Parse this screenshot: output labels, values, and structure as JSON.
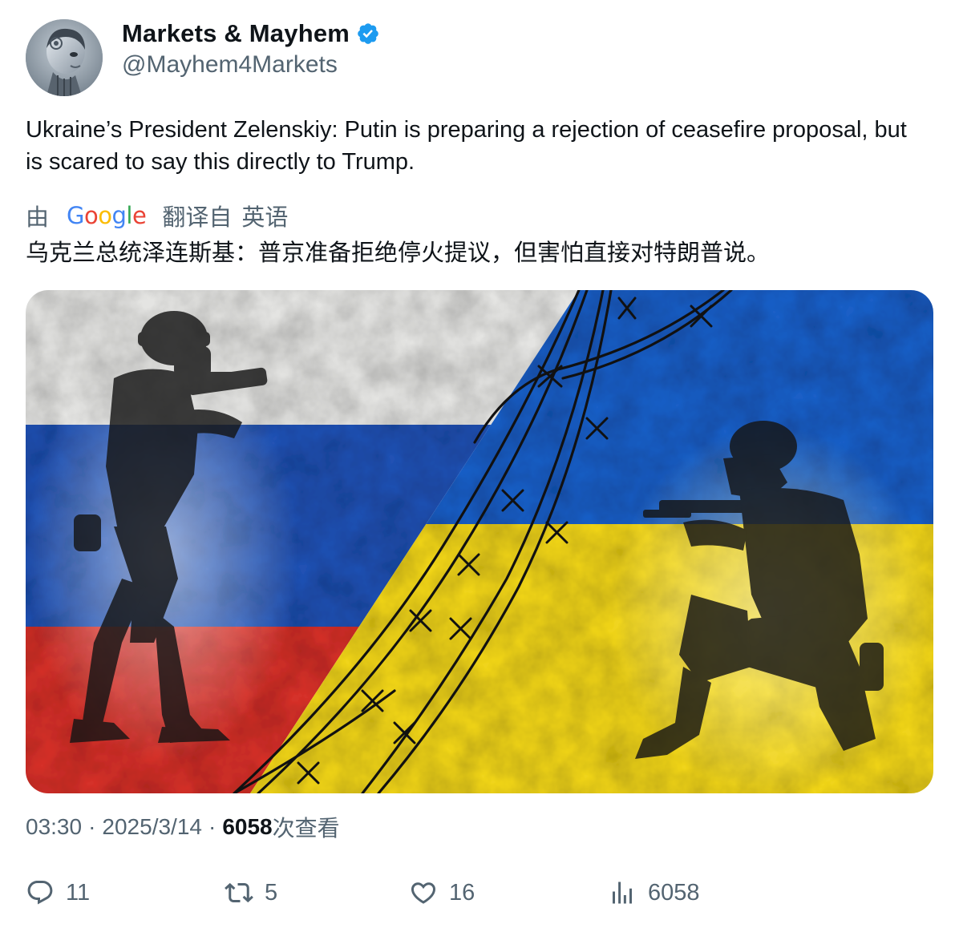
{
  "author": {
    "display_name": "Markets & Mayhem",
    "handle": "@Mayhem4Markets",
    "verified_icon": "verified-badge-icon",
    "verified_color": "#1d9bf0",
    "avatar_icon": "robot-avatar"
  },
  "tweet": {
    "text": "Ukraine’s President Zelenskiy: Putin is preparing a rejection of ceasefire proposal, but is scared to say this directly to Trump.",
    "translation": {
      "by_label": "由",
      "provider": "Google",
      "from_label": "翻译自",
      "language": "英语",
      "text": "乌克兰总统泽连斯基：普京准备拒绝停火提议，但害怕直接对特朗普说。"
    },
    "media_description_icon": "russia-ukraine-flags-soldiers-barbed-wire-image",
    "time": "03:30",
    "separator": "·",
    "date": "2025/3/14",
    "views_count": "6058",
    "views_label": "次查看"
  },
  "actions": {
    "replies": "11",
    "retweets": "5",
    "likes": "16",
    "views": "6058"
  },
  "colors": {
    "text_primary": "#0f1419",
    "text_secondary": "#536471",
    "flag_ru_white": "#e6e6e6",
    "flag_ru_blue": "#1f4fb0",
    "flag_ru_red": "#d6322e",
    "flag_ua_blue": "#1a5cc2",
    "flag_ua_yellow": "#f2d81c"
  }
}
